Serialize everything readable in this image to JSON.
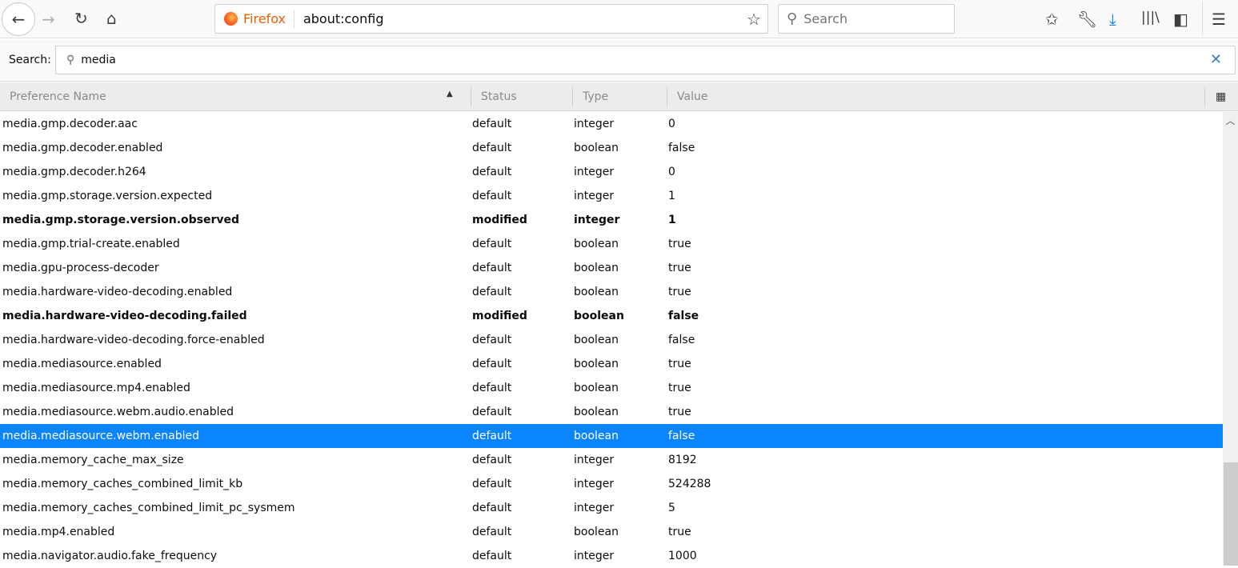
{
  "toolbar": {
    "identity_label": "Firefox",
    "url": "about:config",
    "search_placeholder": "Search"
  },
  "search": {
    "label": "Search:",
    "value": "media"
  },
  "columns": {
    "name": "Preference Name",
    "status": "Status",
    "type": "Type",
    "value": "Value"
  },
  "rows": [
    {
      "name": "media.gmp.decoder.aac",
      "status": "default",
      "type": "integer",
      "value": "0"
    },
    {
      "name": "media.gmp.decoder.enabled",
      "status": "default",
      "type": "boolean",
      "value": "false"
    },
    {
      "name": "media.gmp.decoder.h264",
      "status": "default",
      "type": "integer",
      "value": "0"
    },
    {
      "name": "media.gmp.storage.version.expected",
      "status": "default",
      "type": "integer",
      "value": "1"
    },
    {
      "name": "media.gmp.storage.version.observed",
      "status": "modified",
      "type": "integer",
      "value": "1"
    },
    {
      "name": "media.gmp.trial-create.enabled",
      "status": "default",
      "type": "boolean",
      "value": "true"
    },
    {
      "name": "media.gpu-process-decoder",
      "status": "default",
      "type": "boolean",
      "value": "true"
    },
    {
      "name": "media.hardware-video-decoding.enabled",
      "status": "default",
      "type": "boolean",
      "value": "true"
    },
    {
      "name": "media.hardware-video-decoding.failed",
      "status": "modified",
      "type": "boolean",
      "value": "false"
    },
    {
      "name": "media.hardware-video-decoding.force-enabled",
      "status": "default",
      "type": "boolean",
      "value": "false"
    },
    {
      "name": "media.mediasource.enabled",
      "status": "default",
      "type": "boolean",
      "value": "true"
    },
    {
      "name": "media.mediasource.mp4.enabled",
      "status": "default",
      "type": "boolean",
      "value": "true"
    },
    {
      "name": "media.mediasource.webm.audio.enabled",
      "status": "default",
      "type": "boolean",
      "value": "true"
    },
    {
      "name": "media.mediasource.webm.enabled",
      "status": "default",
      "type": "boolean",
      "value": "false",
      "selected": true
    },
    {
      "name": "media.memory_cache_max_size",
      "status": "default",
      "type": "integer",
      "value": "8192"
    },
    {
      "name": "media.memory_caches_combined_limit_kb",
      "status": "default",
      "type": "integer",
      "value": "524288"
    },
    {
      "name": "media.memory_caches_combined_limit_pc_sysmem",
      "status": "default",
      "type": "integer",
      "value": "5"
    },
    {
      "name": "media.mp4.enabled",
      "status": "default",
      "type": "boolean",
      "value": "true"
    },
    {
      "name": "media.navigator.audio.fake_frequency",
      "status": "default",
      "type": "integer",
      "value": "1000"
    }
  ]
}
